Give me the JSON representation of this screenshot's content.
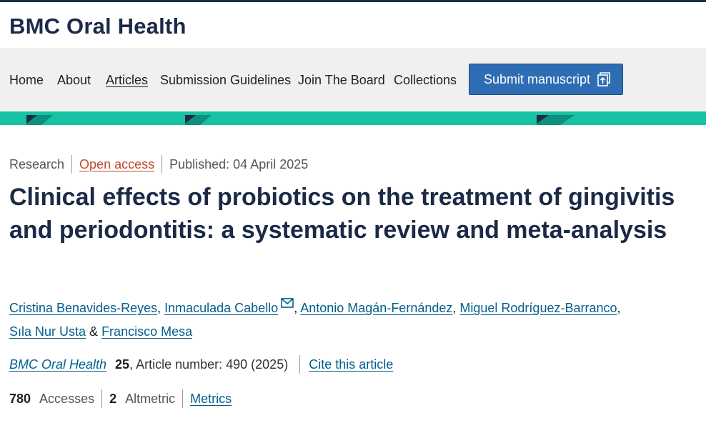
{
  "site": {
    "brand": "BMC Oral Health"
  },
  "nav": {
    "items": [
      {
        "label": "Home"
      },
      {
        "label": "About"
      },
      {
        "label": "Articles"
      },
      {
        "label": "Submission Guidelines"
      },
      {
        "label": "Join The Board"
      },
      {
        "label": "Collections"
      }
    ],
    "submit_label": "Submit manuscript"
  },
  "colors": {
    "navy": "#1b2a47",
    "accent_teal": "#16c2a3",
    "button_blue": "#2e6db4",
    "link_blue": "#025e8d",
    "open_access_orange": "#c0492b"
  },
  "article": {
    "type": "Research",
    "access": "Open access",
    "published": "Published: 04 April 2025",
    "title": "Clinical effects of probiotics on the treatment of gingivitis and periodontitis: a systematic review and meta-analysis",
    "authors": [
      "Cristina Benavides-Reyes",
      "Inmaculada Cabello",
      "Antonio Magán-Fernández",
      "Miguel Rodríguez-Barranco",
      "Sıla Nur Usta",
      "Francisco Mesa"
    ],
    "journal": "BMC Oral Health",
    "volume": "25",
    "article_number": ", Article number: 490 (2025)",
    "cite_label": "Cite this article",
    "accesses_count": "780",
    "accesses_label": "Accesses",
    "altmetric_count": "2",
    "altmetric_label": "Altmetric",
    "metrics_label": "Metrics"
  }
}
